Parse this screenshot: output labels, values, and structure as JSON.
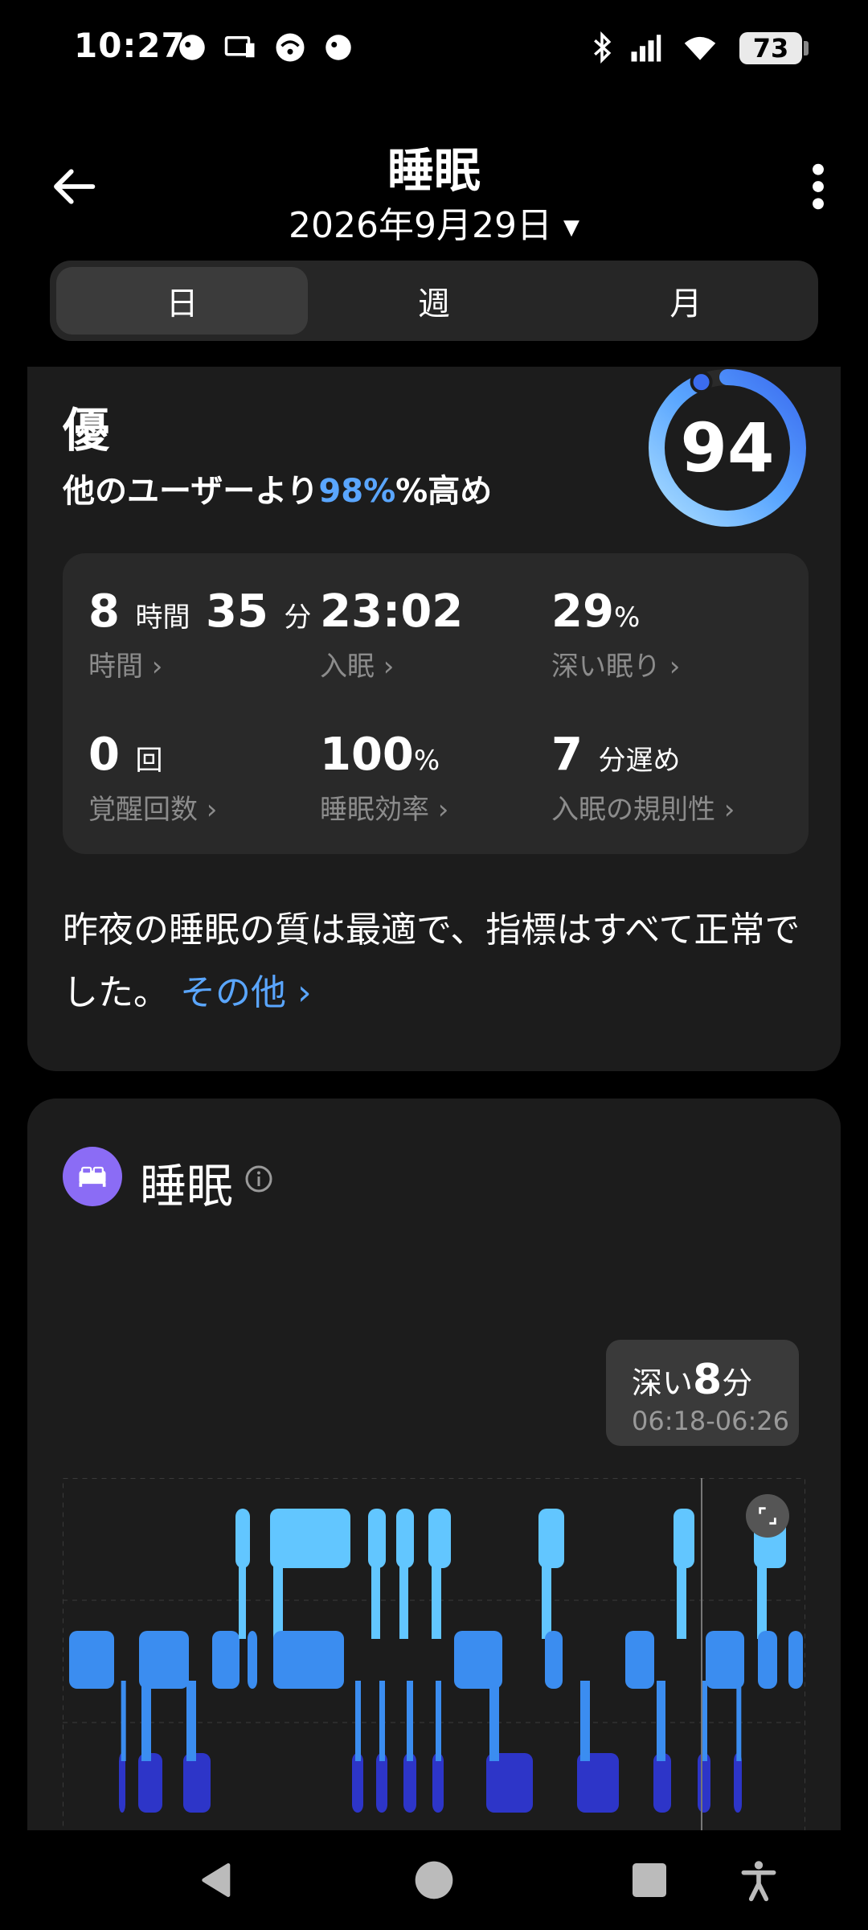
{
  "status_bar": {
    "time": "10:27",
    "battery": "73"
  },
  "header": {
    "title": "睡眠",
    "date": "2026年9月29日"
  },
  "tabs": [
    {
      "label": "日",
      "active": true
    },
    {
      "label": "週",
      "active": false
    },
    {
      "label": "月",
      "active": false
    }
  ],
  "score": {
    "grade": "優",
    "compare_prefix": "他のユーザーより",
    "compare_pct": "98%",
    "compare_suffix": "%高め",
    "value": "94",
    "ring_fraction": 0.94
  },
  "stats": [
    {
      "num1": "8",
      "unit1": "時間",
      "num2": "35",
      "unit2": "分",
      "label": "時間 ›"
    },
    {
      "num1": "23:02",
      "unit1": "",
      "num2": "",
      "unit2": "",
      "label": "入眠 ›"
    },
    {
      "num1": "29",
      "unit1": "%",
      "num2": "",
      "unit2": "",
      "label": "深い眠り ›"
    },
    {
      "num1": "0",
      "unit1": "回",
      "num2": "",
      "unit2": "",
      "label": "覚醒回数 ›"
    },
    {
      "num1": "100",
      "unit1": "%",
      "num2": "",
      "unit2": "",
      "label": "睡眠効率 ›"
    },
    {
      "num1": "7",
      "unit1": "分遅め",
      "num2": "",
      "unit2": "",
      "label": "入眠の規則性 ›"
    }
  ],
  "summary": {
    "text": "昨夜の睡眠の質は最適で、指標はすべて正常でした。",
    "more": "その他 ›"
  },
  "sleep_section": {
    "title": "睡眠",
    "tooltip": {
      "label": "深い",
      "minutes": "8",
      "unit": "分",
      "time_range": "06:18-06:26"
    }
  },
  "colors": {
    "accent": "#5aa6ff",
    "light": "#62c6ff",
    "mid": "#3b8df0",
    "deep": "#2d35c8",
    "badge": "#8b6cf5"
  }
}
